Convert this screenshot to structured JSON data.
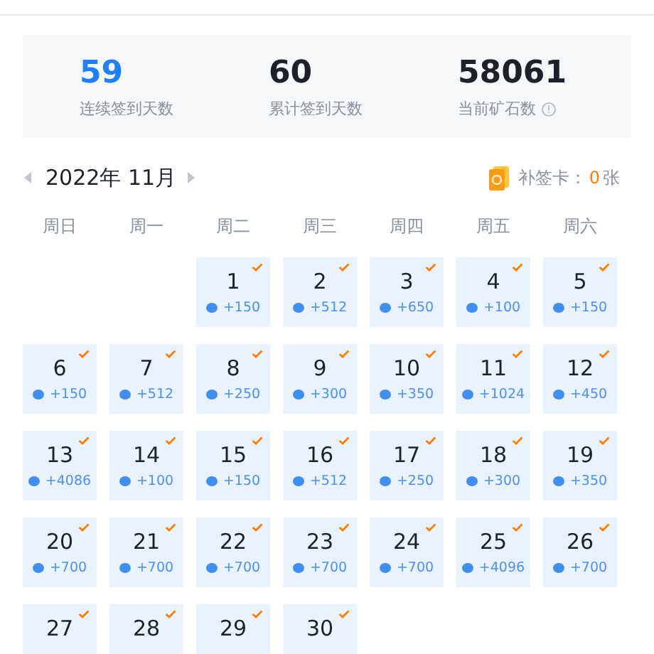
{
  "stats": [
    {
      "value": "59",
      "label": "连续签到天数",
      "highlight": true,
      "info": false
    },
    {
      "value": "60",
      "label": "累计签到天数",
      "highlight": false,
      "info": false
    },
    {
      "value": "58061",
      "label": "当前矿石数",
      "highlight": false,
      "info": true
    }
  ],
  "month": {
    "title": "2022年 11月"
  },
  "makeup_card": {
    "label": "补签卡：",
    "count": "0",
    "unit": "张"
  },
  "weekdays": [
    "周日",
    "周一",
    "周二",
    "周三",
    "周四",
    "周五",
    "周六"
  ],
  "weeks": [
    [
      {
        "kind": "empty"
      },
      {
        "kind": "empty"
      },
      {
        "kind": "day",
        "day": "1",
        "reward": "+150",
        "signed": true
      },
      {
        "kind": "day",
        "day": "2",
        "reward": "+512",
        "signed": true
      },
      {
        "kind": "day",
        "day": "3",
        "reward": "+650",
        "signed": true
      },
      {
        "kind": "day",
        "day": "4",
        "reward": "+100",
        "signed": true
      },
      {
        "kind": "day",
        "day": "5",
        "reward": "+150",
        "signed": true
      }
    ],
    [
      {
        "kind": "day",
        "day": "6",
        "reward": "+150",
        "signed": true
      },
      {
        "kind": "day",
        "day": "7",
        "reward": "+512",
        "signed": true
      },
      {
        "kind": "day",
        "day": "8",
        "reward": "+250",
        "signed": true
      },
      {
        "kind": "day",
        "day": "9",
        "reward": "+300",
        "signed": true
      },
      {
        "kind": "day",
        "day": "10",
        "reward": "+350",
        "signed": true
      },
      {
        "kind": "day",
        "day": "11",
        "reward": "+1024",
        "signed": true
      },
      {
        "kind": "day",
        "day": "12",
        "reward": "+450",
        "signed": true
      }
    ],
    [
      {
        "kind": "day",
        "day": "13",
        "reward": "+4086",
        "signed": true
      },
      {
        "kind": "day",
        "day": "14",
        "reward": "+100",
        "signed": true
      },
      {
        "kind": "day",
        "day": "15",
        "reward": "+150",
        "signed": true
      },
      {
        "kind": "day",
        "day": "16",
        "reward": "+512",
        "signed": true
      },
      {
        "kind": "day",
        "day": "17",
        "reward": "+250",
        "signed": true
      },
      {
        "kind": "day",
        "day": "18",
        "reward": "+300",
        "signed": true
      },
      {
        "kind": "day",
        "day": "19",
        "reward": "+350",
        "signed": true
      }
    ],
    [
      {
        "kind": "day",
        "day": "20",
        "reward": "+700",
        "signed": true
      },
      {
        "kind": "day",
        "day": "21",
        "reward": "+700",
        "signed": true
      },
      {
        "kind": "day",
        "day": "22",
        "reward": "+700",
        "signed": true
      },
      {
        "kind": "day",
        "day": "23",
        "reward": "+700",
        "signed": true
      },
      {
        "kind": "day",
        "day": "24",
        "reward": "+700",
        "signed": true
      },
      {
        "kind": "day",
        "day": "25",
        "reward": "+4096",
        "signed": true
      },
      {
        "kind": "day",
        "day": "26",
        "reward": "+700",
        "signed": true
      }
    ],
    [
      {
        "kind": "day",
        "day": "27",
        "signed": true
      },
      {
        "kind": "day",
        "day": "28",
        "signed": true
      },
      {
        "kind": "day",
        "day": "29",
        "signed": true
      },
      {
        "kind": "day",
        "day": "30",
        "signed": true
      }
    ]
  ]
}
